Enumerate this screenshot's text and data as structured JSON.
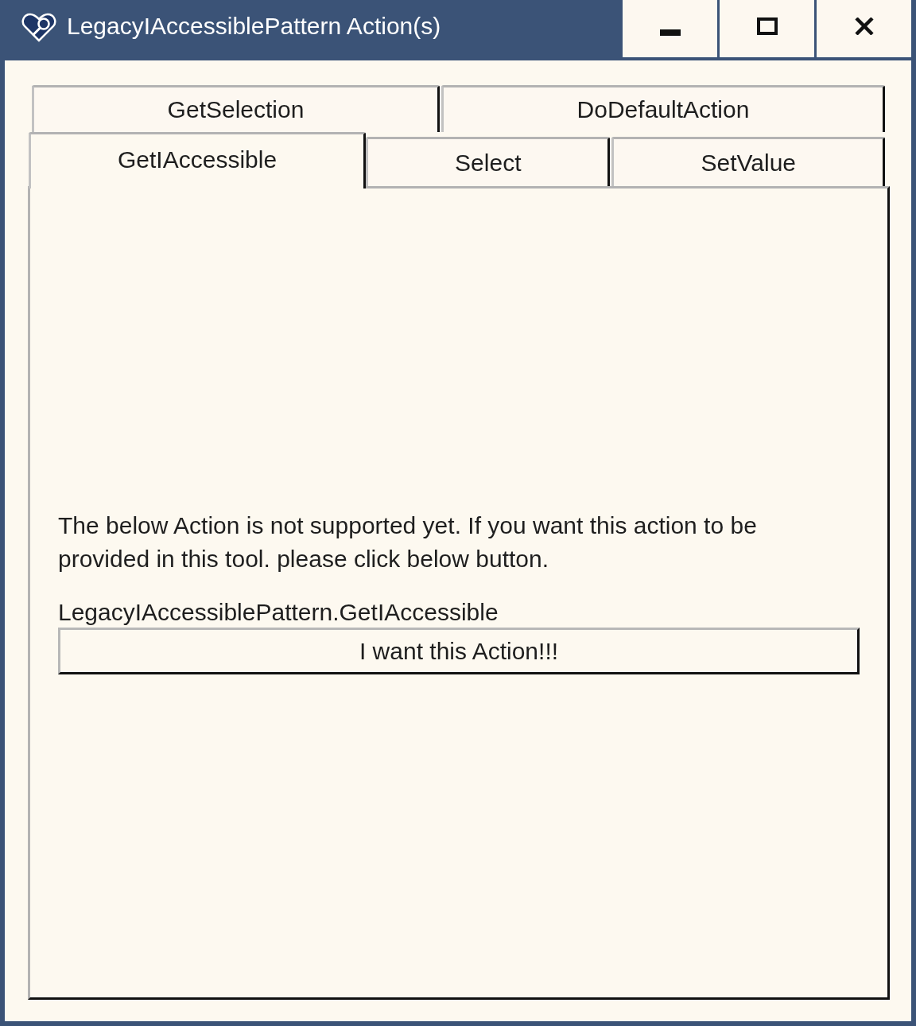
{
  "window": {
    "title": "LegacyIAccessiblePattern Action(s)"
  },
  "tab_rows": [
    {
      "tabs": [
        {
          "label": "GetSelection",
          "selected": false
        },
        {
          "label": "DoDefaultAction",
          "selected": false
        }
      ]
    },
    {
      "tabs": [
        {
          "label": "GetIAccessible",
          "selected": true
        },
        {
          "label": "Select",
          "selected": false
        },
        {
          "label": "SetValue",
          "selected": false
        }
      ]
    }
  ],
  "panel": {
    "message": "The below Action is not supported yet. If you want this action to be provided in this tool. please click below button.",
    "action_name": "LegacyIAccessiblePattern.GetIAccessible",
    "button": {
      "label": "I want this Action!!!"
    }
  }
}
